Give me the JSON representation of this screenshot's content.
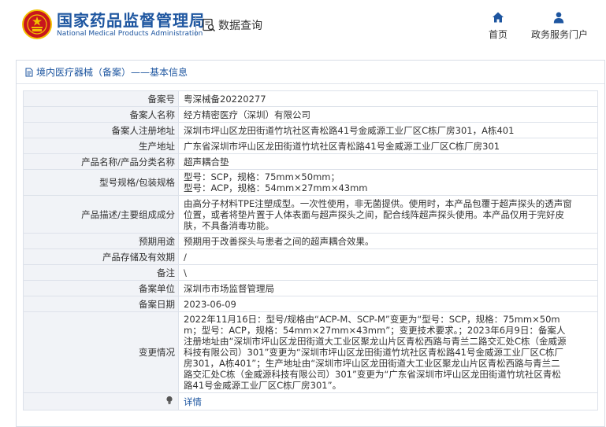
{
  "header": {
    "site_name": "国家药品监督管理局",
    "site_name_en": "National Medical Products Administration",
    "query_label": "数据查询",
    "nav": [
      {
        "label": "首页",
        "icon": "home-icon"
      },
      {
        "label": "政务服务门户",
        "icon": "user-icon"
      }
    ],
    "colors": {
      "brand": "#1e56a0",
      "emblem_red": "#c8161d",
      "emblem_gold": "#f2c200"
    }
  },
  "breadcrumb": "境内医疗器械（备案）——基本信息",
  "record": {
    "rows": [
      {
        "label": "备案号",
        "value": "粤深械备20220277"
      },
      {
        "label": "备案人名称",
        "value": "经方精密医疗（深圳）有限公司"
      },
      {
        "label": "备案人注册地址",
        "value": "深圳市坪山区龙田街道竹坑社区青松路41号金威源工业厂区C栋厂房301，A栋401"
      },
      {
        "label": "生产地址",
        "value": "广东省深圳市坪山区龙田街道竹坑社区青松路41号金威源工业厂区C栋厂房301"
      },
      {
        "label": "产品名称/产品分类名称",
        "value": "超声耦合垫"
      },
      {
        "label": "型号规格/包装规格",
        "value_lines": [
          "型号：SCP，规格：75mm×50mm；",
          "型号：ACP，规格：54mm×27mm×43mm"
        ]
      },
      {
        "label": "产品描述/主要组成成分",
        "value_lines": [
          "由高分子材料TPE注塑成型。一次性使用，非无菌提供。使用时，本产品包覆于超声探头的透声窗",
          "位置，或者将垫片置于人体表面与超声探头之间，配合线阵超声探头使用。本产品仅用于完好皮",
          "肤，不具备消毒功能。"
        ]
      },
      {
        "label": "预期用途",
        "value": "预期用于改善探头与患者之间的超声耦合效果。"
      },
      {
        "label": "产品存储及有效期",
        "value": "/"
      },
      {
        "label": "备注",
        "value": "\\"
      },
      {
        "label": "备案单位",
        "value": "深圳市市场监督管理局"
      },
      {
        "label": "备案日期",
        "value": "2023-06-09"
      },
      {
        "label": "变更情况",
        "value_lines": [
          "2022年11月16日：型号/规格由“ACP-M、SCP-M”变更为“型号：SCP，规格：75mm×50m",
          "m；型号：ACP，规格：54mm×27mm×43mm”；变更技术要求。；2023年6月9日：备案人",
          "注册地址由“深圳市坪山区龙田街道大工业区聚龙山片区青松西路与青兰二路交汇处C栋（金威源",
          "科技有限公司）301”变更为“深圳市坪山区龙田街道竹坑社区青松路41号金威源工业厂区C栋厂",
          "房301，A栋401”；生产地址由“深圳市坪山区龙田街道大工业区聚龙山片区青松西路与青兰二",
          "路交汇处C栋（金威源科技有限公司）301”变更为“广东省深圳市坪山区龙田街道竹坑社区青松",
          "路41号金威源工业厂区C栋厂房301”。"
        ]
      },
      {
        "label": "",
        "value": "详情",
        "is_link": true,
        "icon": "lightbulb-icon"
      }
    ]
  }
}
